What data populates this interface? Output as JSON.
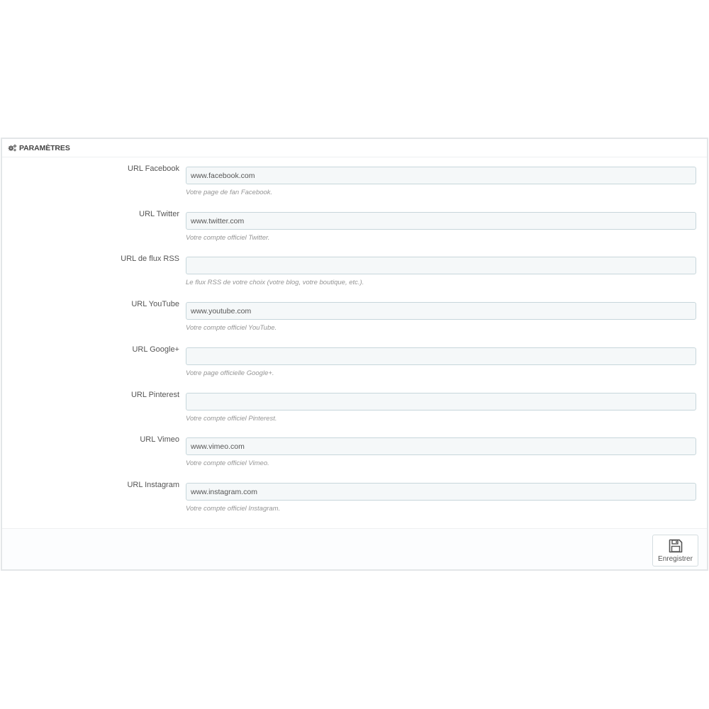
{
  "panel": {
    "title": "PARAMÈTRES",
    "title_icon": "cogs-icon"
  },
  "fields": [
    {
      "label": "URL Facebook",
      "value": "www.facebook.com",
      "help": "Votre page de fan Facebook."
    },
    {
      "label": "URL Twitter",
      "value": "www.twitter.com",
      "help": "Votre compte officiel Twitter."
    },
    {
      "label": "URL de flux RSS",
      "value": "",
      "help": "Le flux RSS de votre choix (votre blog, votre boutique, etc.)."
    },
    {
      "label": "URL YouTube",
      "value": "www.youtube.com",
      "help": "Votre compte officiel YouTube."
    },
    {
      "label": "URL Google+",
      "value": "",
      "help": "Votre page officielle Google+."
    },
    {
      "label": "URL Pinterest",
      "value": "",
      "help": "Votre compte officiel Pinterest."
    },
    {
      "label": "URL Vimeo",
      "value": "www.vimeo.com",
      "help": "Votre compte officiel Vimeo."
    },
    {
      "label": "URL Instagram",
      "value": "www.instagram.com",
      "help": "Votre compte officiel Instagram."
    }
  ],
  "footer": {
    "save_label": "Enregistrer",
    "save_icon": "floppy-disk-icon"
  },
  "colors": {
    "input_background": "#f5f8f9",
    "input_border": "#c7d6db",
    "panel_border": "#e3e6e8",
    "help_text": "#959595"
  }
}
